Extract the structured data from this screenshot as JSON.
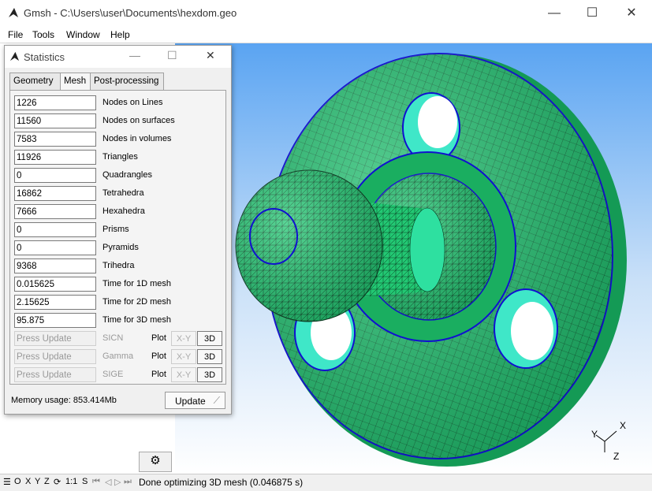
{
  "window": {
    "title": "Gmsh - C:\\Users\\user\\Documents\\hexdom.geo",
    "minimize": "—",
    "maximize": "☐",
    "close": "✕"
  },
  "menu": [
    "File",
    "Tools",
    "Window",
    "Help"
  ],
  "dialog": {
    "title": "Statistics",
    "tabs": [
      "Geometry",
      "Mesh",
      "Post-processing"
    ],
    "active_tab": "Mesh",
    "rows": [
      {
        "value": "1226",
        "label": "Nodes on Lines"
      },
      {
        "value": "11560",
        "label": "Nodes on surfaces"
      },
      {
        "value": "7583",
        "label": "Nodes in volumes"
      },
      {
        "value": "11926",
        "label": "Triangles"
      },
      {
        "value": "0",
        "label": "Quadrangles"
      },
      {
        "value": "16862",
        "label": "Tetrahedra"
      },
      {
        "value": "7666",
        "label": "Hexahedra"
      },
      {
        "value": "0",
        "label": "Prisms"
      },
      {
        "value": "0",
        "label": "Pyramids"
      },
      {
        "value": "9368",
        "label": "Trihedra"
      },
      {
        "value": "0.015625",
        "label": "Time for 1D mesh"
      },
      {
        "value": "2.15625",
        "label": "Time for 2D mesh"
      },
      {
        "value": "95.875",
        "label": "Time for 3D mesh"
      }
    ],
    "quality_rows": [
      {
        "placeholder": "Press Update",
        "label": "SICN",
        "plot": "Plot",
        "xy": "X-Y",
        "btn3d": "3D"
      },
      {
        "placeholder": "Press Update",
        "label": "Gamma",
        "plot": "Plot",
        "xy": "X-Y",
        "btn3d": "3D"
      },
      {
        "placeholder": "Press Update",
        "label": "SIGE",
        "plot": "Plot",
        "xy": "X-Y",
        "btn3d": "3D"
      }
    ],
    "memory": "Memory usage: 853.414Mb",
    "update_label": "Update"
  },
  "axes": {
    "x": "X",
    "y": "Y",
    "z": "Z"
  },
  "statusbar": {
    "buttons": [
      "☰",
      "O",
      "X",
      "Y",
      "Z",
      "⟳",
      "1:1",
      "S",
      "⏮",
      "◁",
      "▷",
      "⏭"
    ],
    "message": "Done optimizing 3D mesh (0.046875 s)"
  },
  "colors": {
    "mesh": "#1fbf6e",
    "mesh_edge": "#000000",
    "boundary": "#1010d0",
    "bg_top": "#5aa4f2",
    "bg_bottom": "#ffffff"
  }
}
